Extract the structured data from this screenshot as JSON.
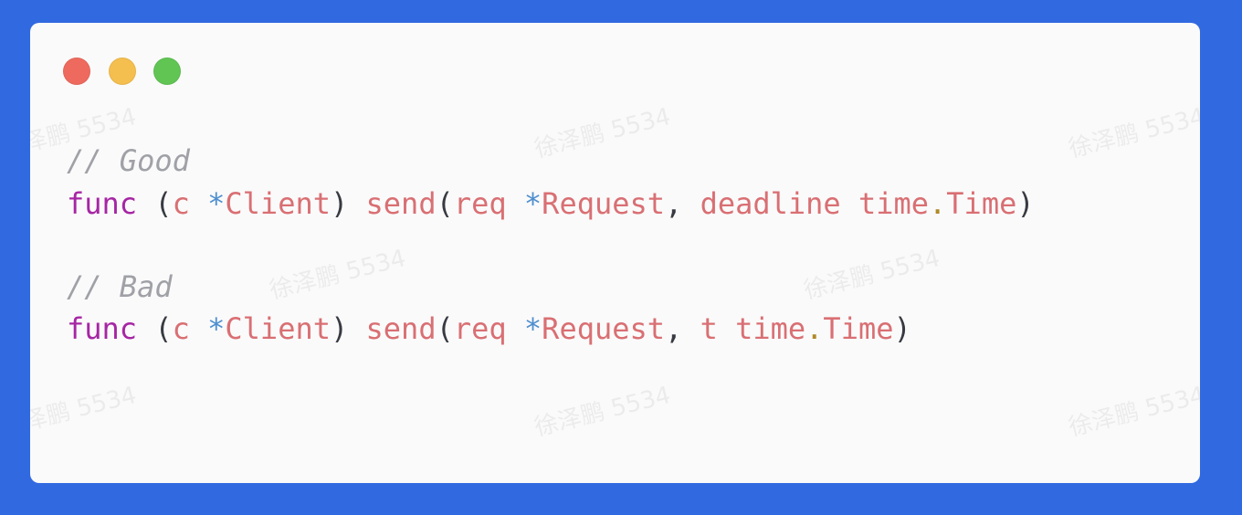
{
  "window": {
    "buttons": {
      "close": "close-button",
      "minimize": "minimize-button",
      "zoom": "zoom-button"
    },
    "colors": {
      "background": "#3169e0",
      "card": "#fafafa",
      "red": "#ef6a5e",
      "yellow": "#f5bf4f",
      "green": "#61c554"
    }
  },
  "code": {
    "good_comment": "// Good",
    "good": {
      "kw": "func",
      "open": " (",
      "recv": "c",
      "sp1": " ",
      "star1": "*",
      "type1": "Client",
      "close": ")",
      "sp2": " ",
      "name": "send",
      "paren_open": "(",
      "arg1": "req",
      "sp3": " ",
      "star2": "*",
      "type2": "Request",
      "comma": ",",
      "sp4": " ",
      "arg2": "deadline",
      "sp5": " ",
      "pkg": "time",
      "dot": ".",
      "type3": "Time",
      "paren_close": ")"
    },
    "bad_comment": "// Bad",
    "bad": {
      "kw": "func",
      "open": " (",
      "recv": "c",
      "sp1": " ",
      "star1": "*",
      "type1": "Client",
      "close": ")",
      "sp2": " ",
      "name": "send",
      "paren_open": "(",
      "arg1": "req",
      "sp3": " ",
      "star2": "*",
      "type2": "Request",
      "comma": ",",
      "sp4": " ",
      "arg2": "t",
      "sp5": " ",
      "pkg": "time",
      "dot": ".",
      "type3": "Time",
      "paren_close": ")"
    }
  },
  "watermark": "徐泽鹏 5534"
}
